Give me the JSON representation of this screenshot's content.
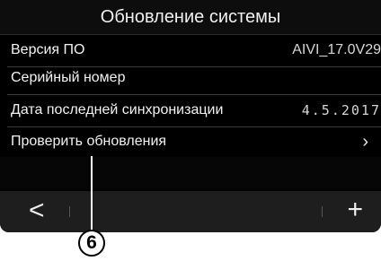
{
  "header": {
    "title": "Обновление системы"
  },
  "rows": [
    {
      "label": "Версия ПО",
      "value": "AIVI_17.0V29"
    },
    {
      "label": "Серийный номер",
      "value": ""
    },
    {
      "label": "Дата последней синхронизации",
      "value": "4.5.2017"
    },
    {
      "label": "Проверить обновления",
      "chevron": "›"
    }
  ],
  "bottom_bar": {
    "back_icon": "<",
    "plus_icon": "+"
  },
  "callout": {
    "number": "6"
  },
  "colors": {
    "screen_bg": "#000000",
    "bottom_bar_bg": "#1e1e1e",
    "text": "#f2f2f2"
  }
}
